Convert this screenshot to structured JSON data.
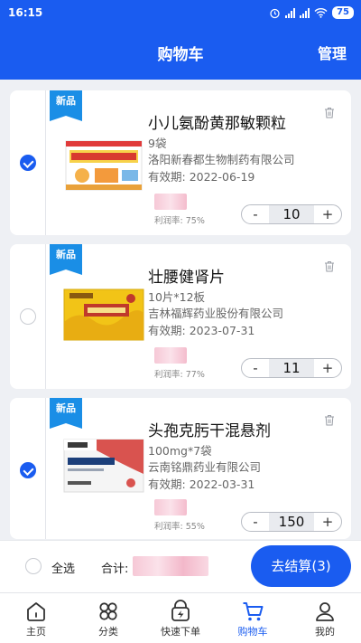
{
  "status_bar": {
    "time": "16:15",
    "battery": "75"
  },
  "header": {
    "title": "购物车",
    "manage_label": "管理"
  },
  "cart_items": [
    {
      "badge": "新品",
      "name": "小儿氨酚黄那敏颗粒",
      "spec": "9袋",
      "manufacturer": "洛阳新春都生物制药有限公司",
      "expiry_label": "有效期:",
      "expiry": "2022-06-19",
      "profit_label": "利润率:",
      "profit": "75%",
      "quantity": "10",
      "checked": true
    },
    {
      "badge": "新品",
      "name": "壮腰健肾片",
      "spec": "10片*12板",
      "manufacturer": "吉林福辉药业股份有限公司",
      "expiry_label": "有效期:",
      "expiry": "2023-07-31",
      "profit_label": "利润率:",
      "profit": "77%",
      "quantity": "11",
      "checked": false
    },
    {
      "badge": "新品",
      "name": "头孢克肟干混悬剂",
      "spec": "100mg*7袋",
      "manufacturer": "云南铭鼎药业有限公司",
      "expiry_label": "有效期:",
      "expiry": "2022-03-31",
      "profit_label": "利润率:",
      "profit": "55%",
      "quantity": "150",
      "checked": true
    }
  ],
  "stepper": {
    "minus": "-",
    "plus": "+"
  },
  "summary": {
    "select_all_label": "全选",
    "total_label": "合计:",
    "checkout_label": "去结算(3)"
  },
  "tabbar": [
    {
      "label": "主页",
      "icon": "home-icon"
    },
    {
      "label": "分类",
      "icon": "category-icon"
    },
    {
      "label": "快速下单",
      "icon": "quick-order-icon"
    },
    {
      "label": "购物车",
      "icon": "cart-icon",
      "active": true
    },
    {
      "label": "我的",
      "icon": "profile-icon"
    }
  ],
  "colors": {
    "primary": "#1a5cf0",
    "badge": "#1a8ee6"
  }
}
